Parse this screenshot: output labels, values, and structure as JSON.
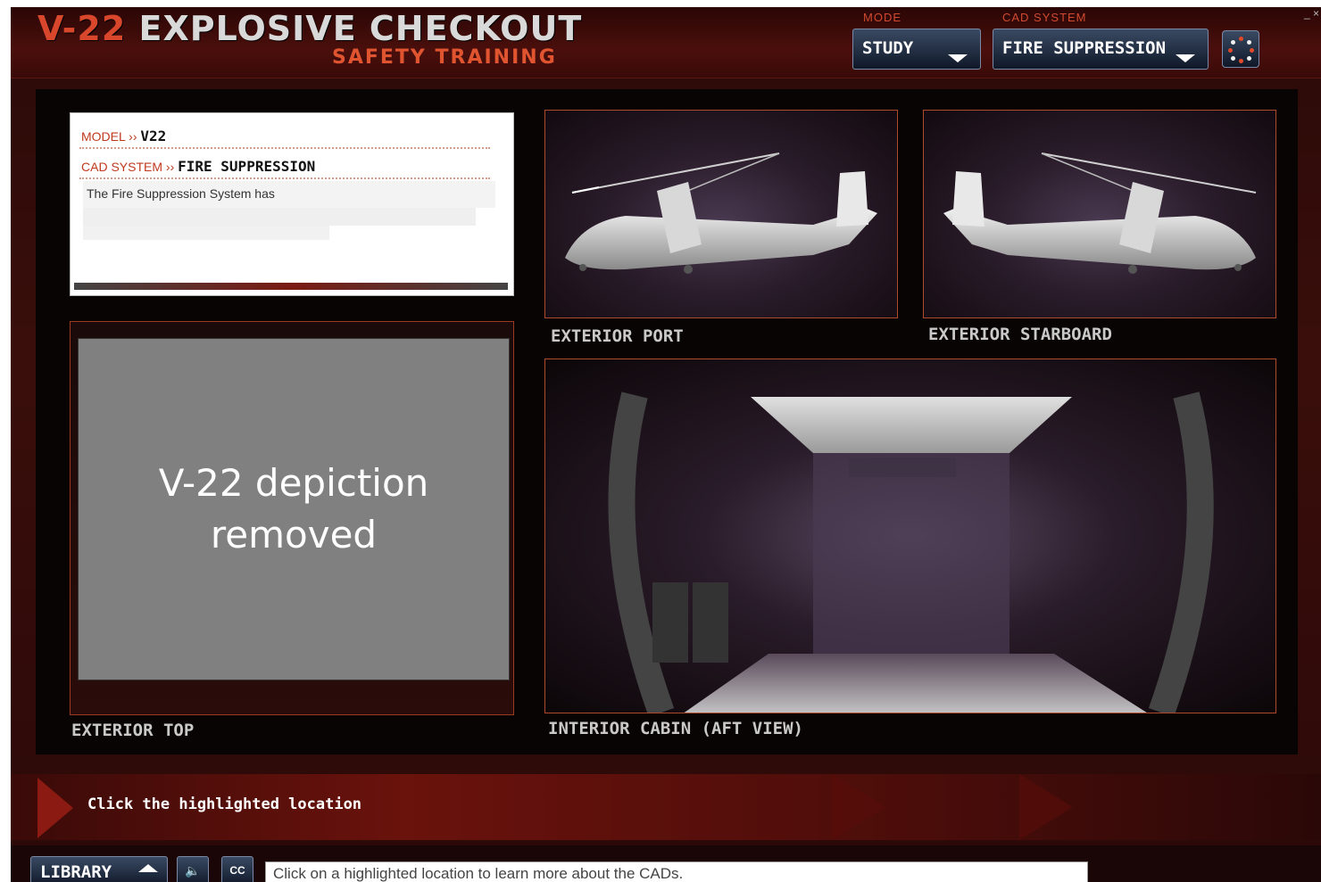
{
  "header": {
    "title_prefix": "V-22",
    "title_main": "EXPLOSIVE CHECKOUT",
    "subtitle": "SAFETY TRAINING",
    "mode_label": "MODE",
    "mode_value": "STUDY",
    "cad_label": "CAD SYSTEM",
    "cad_value": "FIRE SUPPRESSION",
    "window_controls": "_ ×"
  },
  "info_card": {
    "model_label": "MODEL ››",
    "model_value": "V22",
    "cad_label": "CAD SYSTEM ››",
    "cad_value": "FIRE SUPPRESSION",
    "description": "The Fire Suppression System has"
  },
  "views": {
    "exterior_top": "EXTERIOR TOP",
    "exterior_port": "EXTERIOR PORT",
    "exterior_starboard": "EXTERIOR STARBOARD",
    "interior_cabin": "INTERIOR CABIN (AFT VIEW)",
    "placeholder_line1": "V-22 depiction",
    "placeholder_line2": "removed"
  },
  "prompt": {
    "text": "Click the highlighted location"
  },
  "footer": {
    "library_label": "LIBRARY",
    "audio_icon": "speaker-icon",
    "cc_label": "CC",
    "status_text": "Click on a highlighted location to learn more about the CADs."
  },
  "colors": {
    "accent": "#d8472c",
    "frame_border": "#b04a2c",
    "button_bg": "#1f2b40"
  }
}
